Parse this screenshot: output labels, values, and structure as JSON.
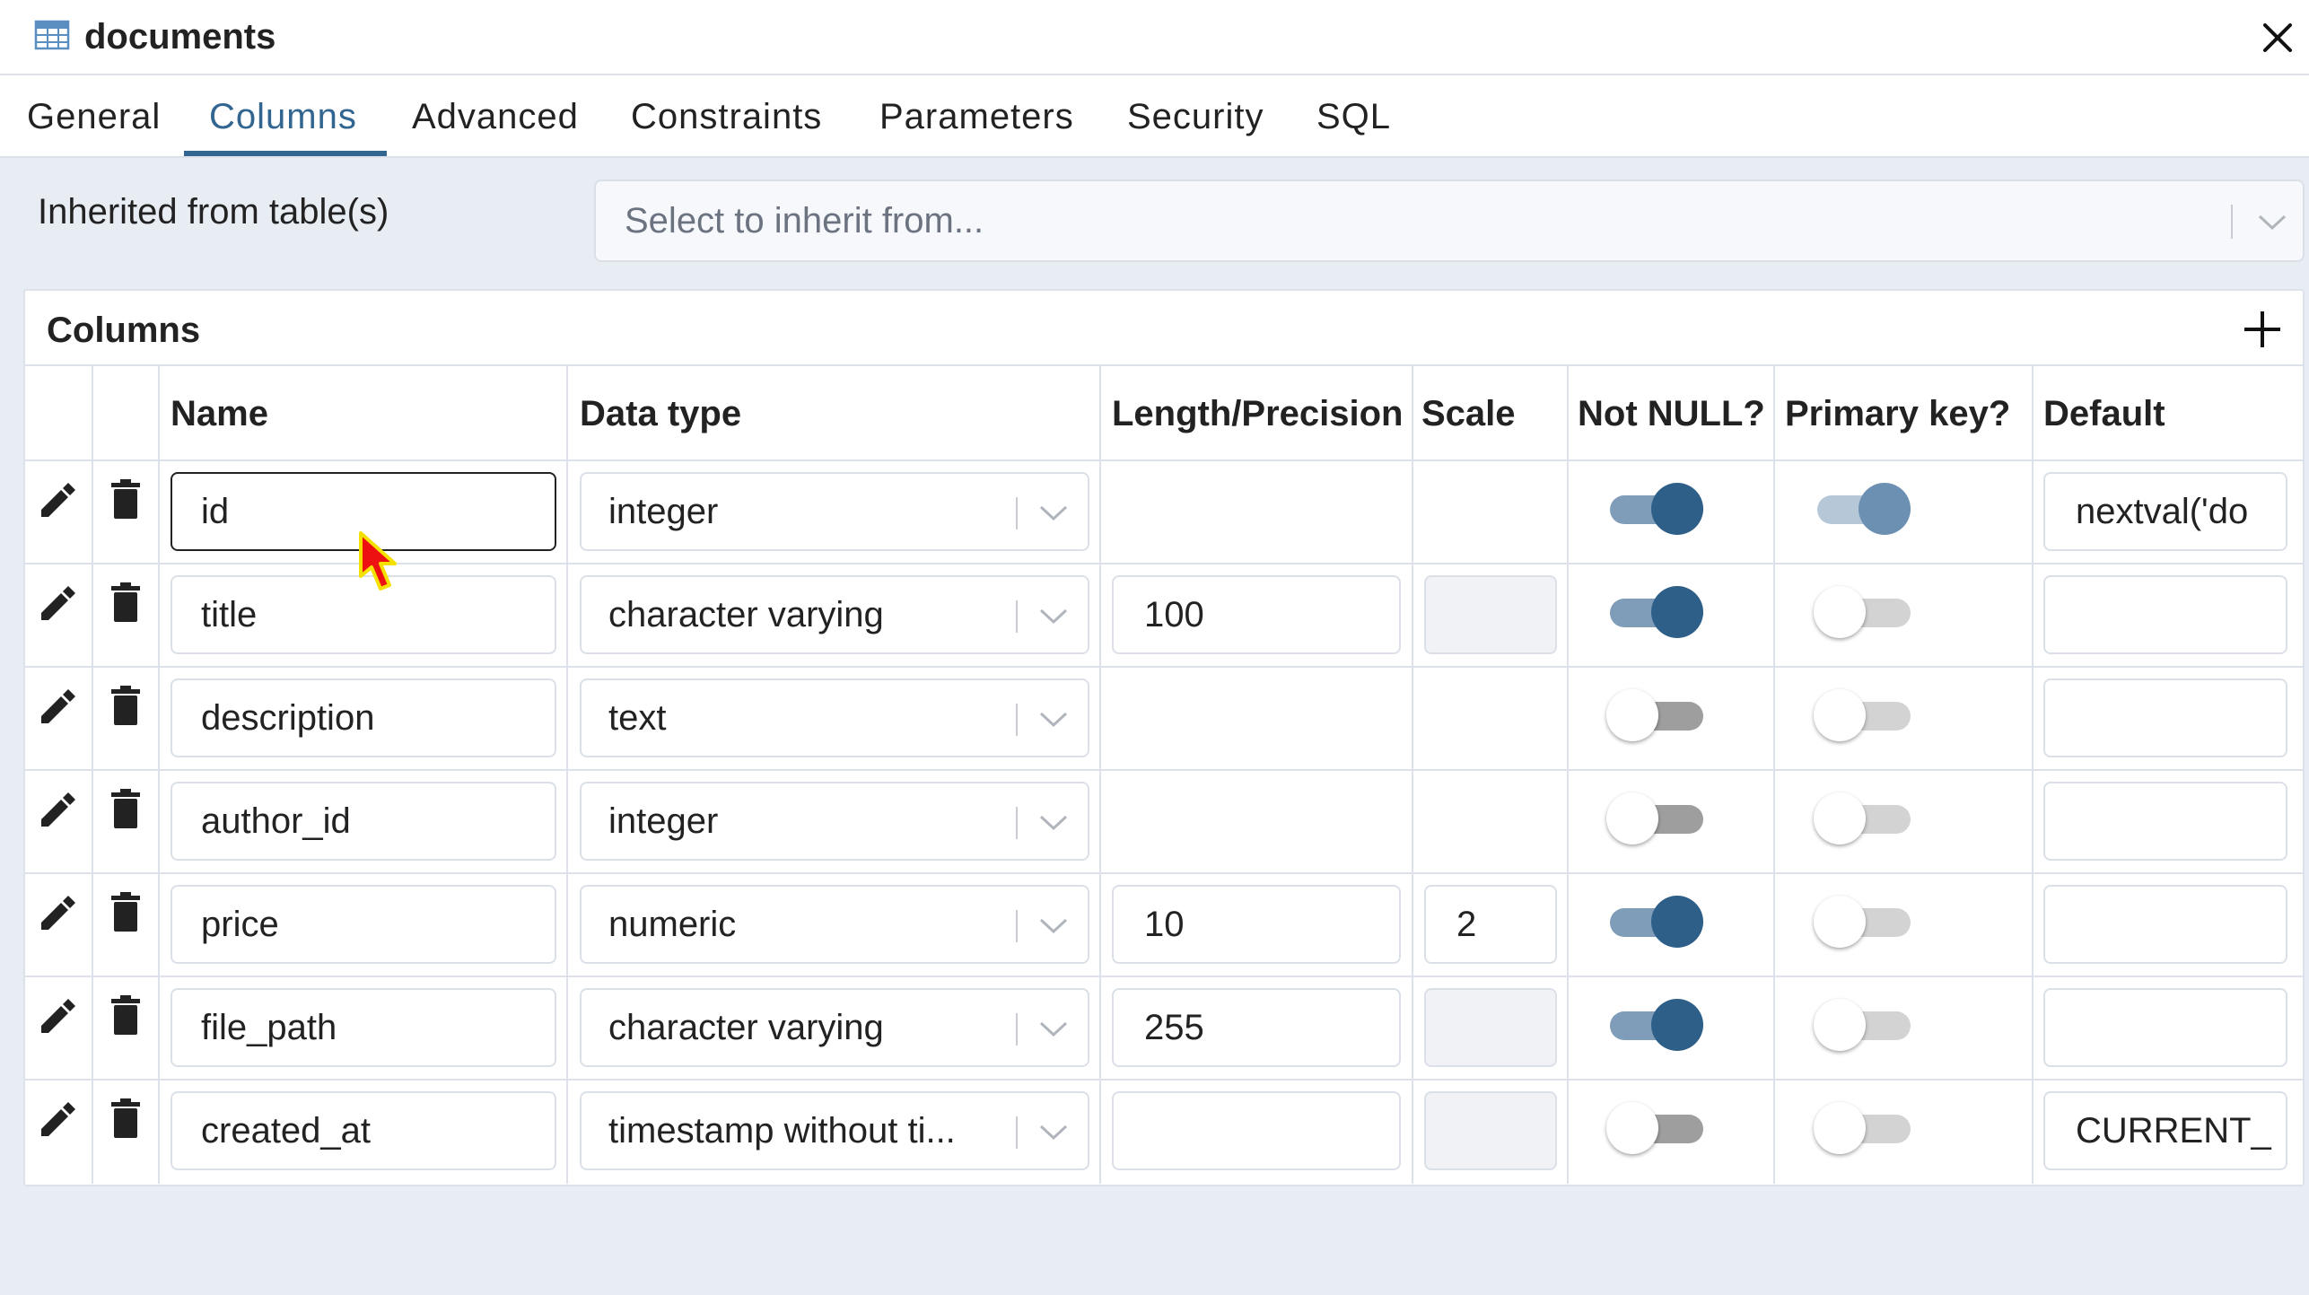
{
  "window": {
    "title": "documents",
    "title_icon": "table-icon",
    "close_icon": "close-icon"
  },
  "tabs": [
    {
      "label": "General",
      "active": false
    },
    {
      "label": "Columns",
      "active": true
    },
    {
      "label": "Advanced",
      "active": false
    },
    {
      "label": "Constraints",
      "active": false
    },
    {
      "label": "Parameters",
      "active": false
    },
    {
      "label": "Security",
      "active": false
    },
    {
      "label": "SQL",
      "active": false
    }
  ],
  "inherit": {
    "label": "Inherited from table(s)",
    "placeholder": "Select to inherit from..."
  },
  "columns_panel": {
    "title": "Columns",
    "add_icon": "plus-icon",
    "headers": {
      "name": "Name",
      "data_type": "Data type",
      "length": "Length/Precision",
      "scale": "Scale",
      "not_null": "Not NULL?",
      "primary_key": "Primary key?",
      "default": "Default"
    },
    "rows": [
      {
        "name": "id",
        "data_type": "integer",
        "length": "",
        "scale": "",
        "not_null": true,
        "primary_key": true,
        "default": "nextval('do"
      },
      {
        "name": "title",
        "data_type": "character varying",
        "length": "100",
        "scale": "",
        "not_null": true,
        "primary_key": false,
        "default": ""
      },
      {
        "name": "description",
        "data_type": "text",
        "length": "",
        "scale": "",
        "not_null": false,
        "primary_key": false,
        "default": ""
      },
      {
        "name": "author_id",
        "data_type": "integer",
        "length": "",
        "scale": "",
        "not_null": false,
        "primary_key": false,
        "default": ""
      },
      {
        "name": "price",
        "data_type": "numeric",
        "length": "10",
        "scale": "2",
        "not_null": true,
        "primary_key": false,
        "default": ""
      },
      {
        "name": "file_path",
        "data_type": "character varying",
        "length": "255",
        "scale": "",
        "not_null": true,
        "primary_key": false,
        "default": ""
      },
      {
        "name": "created_at",
        "data_type": "timestamp without ti...",
        "length": "",
        "scale": "",
        "not_null": false,
        "primary_key": false,
        "default": "CURRENT_"
      }
    ]
  },
  "colors": {
    "accent": "#326690",
    "toggle_on": "#2d5f89",
    "toggle_track_on": "#7f9cb8",
    "background": "#e8ecf3"
  }
}
